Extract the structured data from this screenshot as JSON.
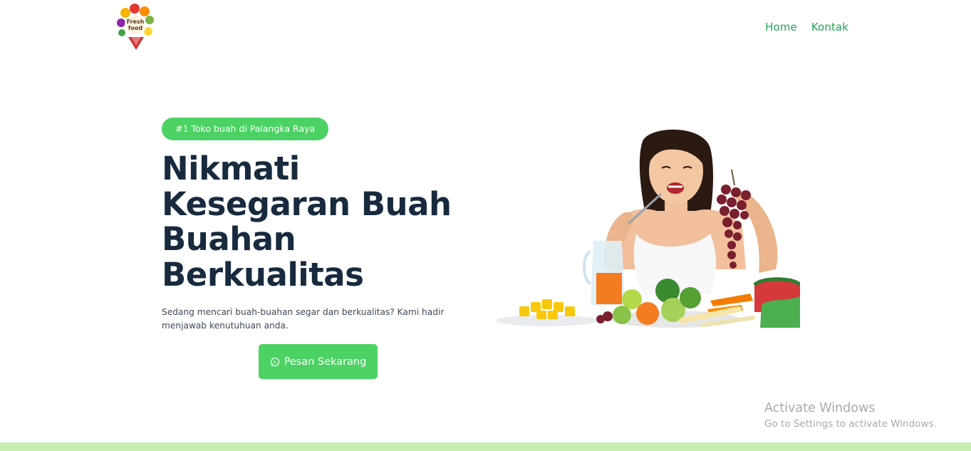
{
  "header": {
    "logo": {
      "text_line1": "Fresh",
      "text_line2": "food",
      "icon": "fresh-food-logo"
    },
    "nav": [
      {
        "label": "Home"
      },
      {
        "label": "Kontak"
      }
    ]
  },
  "hero": {
    "badge": "#1 Toko buah di Palangka Raya",
    "title_lines": [
      "Nikmati",
      "Kesegaran Buah",
      "Buahan",
      "Berkualitas"
    ],
    "description": "Sedang mencari buah-buahan segar dan berkualitas? Kami hadir menjawab kenutuhuan anda.",
    "cta": {
      "label": "Pesan Sekarang",
      "icon": "whatsapp-icon"
    },
    "image": "woman-eating-fruits-illustration"
  },
  "watermark": {
    "line1": "Activate Windows",
    "line2": "Go to Settings to activate Windows."
  },
  "colors": {
    "accent": "#4cd163",
    "nav_text": "#23a455",
    "heading": "#172a3e",
    "footer_strip": "#c7eeb1"
  }
}
